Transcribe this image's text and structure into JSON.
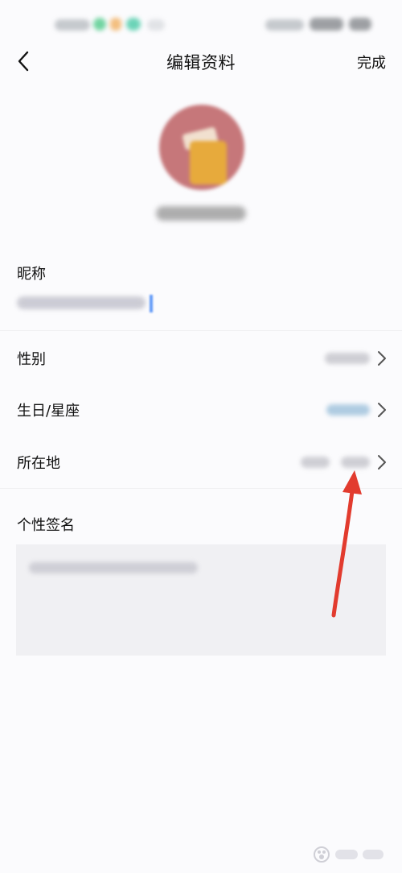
{
  "header": {
    "title": "编辑资料",
    "done_label": "完成"
  },
  "profile": {
    "nickname_label": "昵称",
    "gender_label": "性别",
    "birthday_label": "生日/星座",
    "location_label": "所在地",
    "signature_label": "个性签名"
  },
  "icons": {
    "back": "chevron-left-icon",
    "row_arrow": "chevron-right-icon"
  },
  "colors": {
    "background": "#fbfbfd",
    "avatar": "#c6777a",
    "annotation_arrow": "#e23b2e",
    "cursor": "#3b82f6"
  }
}
